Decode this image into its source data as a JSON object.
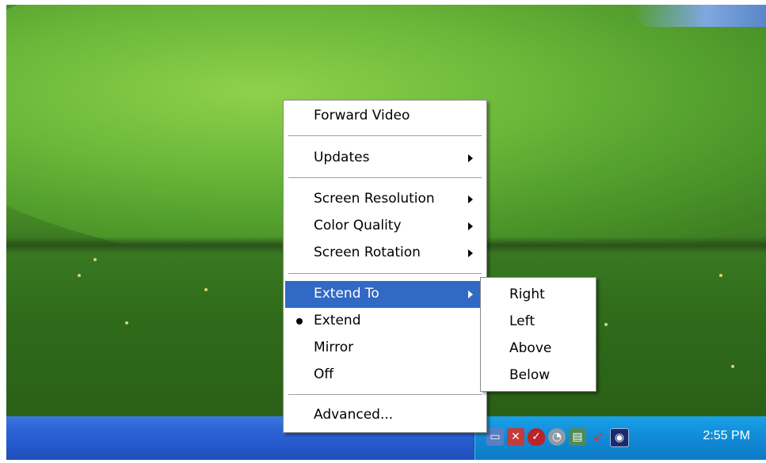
{
  "context_menu": {
    "items": [
      {
        "label": "Forward Video"
      },
      {
        "label": "Updates"
      },
      {
        "label": "Screen Resolution"
      },
      {
        "label": "Color Quality"
      },
      {
        "label": "Screen Rotation"
      },
      {
        "label": "Extend To",
        "highlighted": true
      },
      {
        "label": "Extend",
        "checked": true
      },
      {
        "label": "Mirror"
      },
      {
        "label": "Off"
      },
      {
        "label": "Advanced..."
      }
    ]
  },
  "submenu": {
    "parent": "Extend To",
    "items": [
      {
        "label": "Right"
      },
      {
        "label": "Left"
      },
      {
        "label": "Above"
      },
      {
        "label": "Below"
      }
    ]
  },
  "taskbar": {
    "clock": "2:55 PM",
    "tray_icons": [
      "network-icon",
      "security-alert-icon",
      "shield-icon",
      "volume-icon",
      "display-icon",
      "red-bird-icon",
      "wireless-icon"
    ]
  },
  "colors": {
    "highlight": "#316ac5",
    "taskbar": "#2356c9",
    "tray": "#118ad6"
  }
}
